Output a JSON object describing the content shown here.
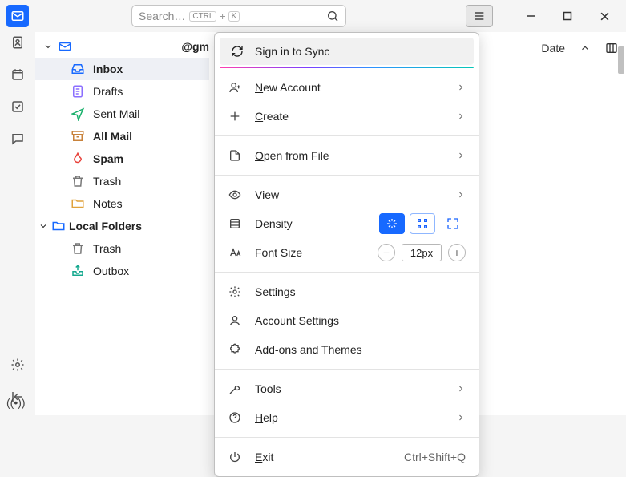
{
  "search": {
    "placeholder": "Search…",
    "kbd_ctrl": "CTRL",
    "kbd_plus": "+",
    "kbd_k": "K"
  },
  "account": {
    "label": "@gm"
  },
  "folders": {
    "inbox": "Inbox",
    "drafts": "Drafts",
    "sent": "Sent Mail",
    "all": "All Mail",
    "spam": "Spam",
    "trash": "Trash",
    "notes": "Notes"
  },
  "local_header": "Local Folders",
  "local": {
    "trash": "Trash",
    "outbox": "Outbox"
  },
  "msg_header": {
    "date": "Date"
  },
  "menu": {
    "sync": "Sign in to Sync",
    "new_account": "New Account",
    "create": "Create",
    "open_file": "Open from File",
    "view": "View",
    "density": "Density",
    "font_size": "Font Size",
    "font_size_value": "12px",
    "settings": "Settings",
    "account_settings": "Account Settings",
    "addons": "Add-ons and Themes",
    "tools": "Tools",
    "help": "Help",
    "exit": "Exit",
    "exit_shortcut": "Ctrl+Shift+Q"
  },
  "sync_status": "((•))"
}
